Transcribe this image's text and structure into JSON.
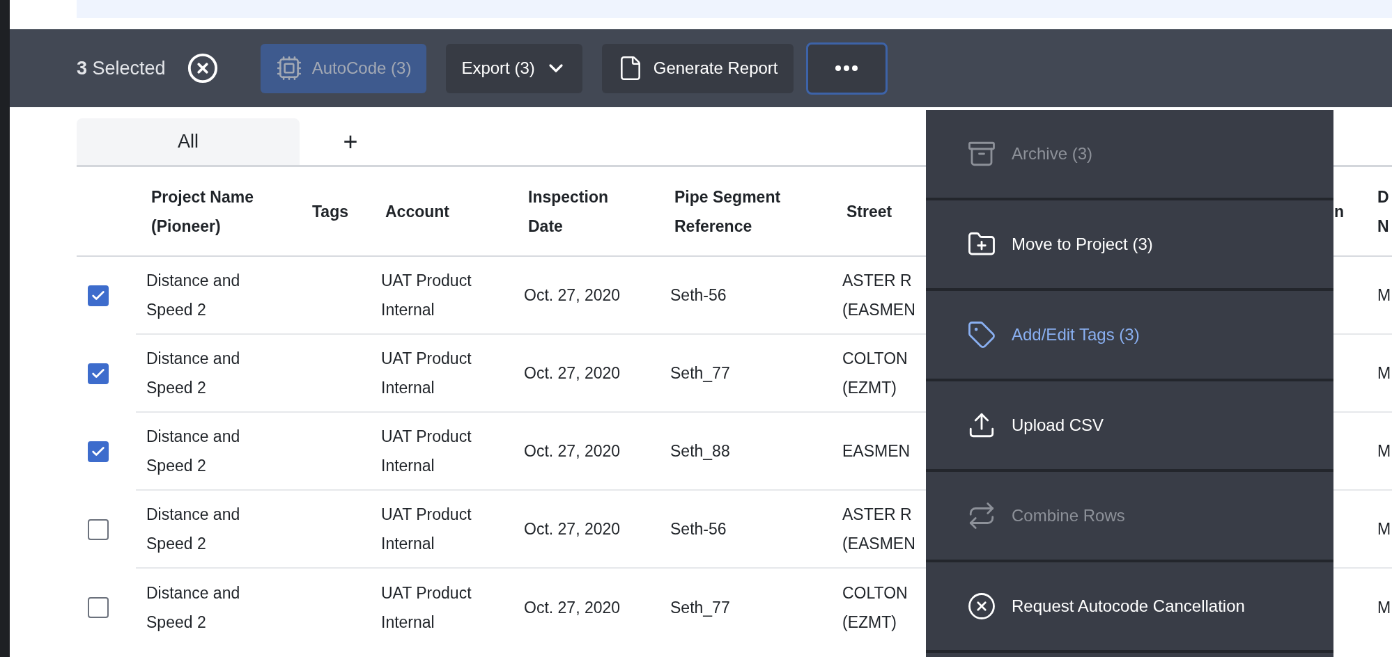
{
  "toolbar": {
    "count": "3",
    "selected_label": "Selected",
    "buttons": [
      {
        "kind": "autocode",
        "label": "AutoCode (3)",
        "disabled": true
      },
      {
        "kind": "dropdown",
        "label": "Export (3)",
        "disabled": false
      },
      {
        "kind": "report",
        "label": "Generate Report",
        "disabled": false
      }
    ],
    "more_button": {
      "expanded": true
    }
  },
  "tabs": [
    {
      "label": "All",
      "selected": true
    }
  ],
  "add_tab": "+",
  "table": {
    "columns": [
      "Project Name (Pioneer)",
      "Tags",
      "Account",
      "Inspection Date",
      "Pipe Segment Reference",
      "Street",
      "n",
      "D N"
    ],
    "rows": [
      {
        "checked": true,
        "cells": [
          "Distance and Speed 2",
          "",
          "UAT Product Internal",
          "Oct. 27, 2020",
          "Seth-56",
          "ASTER R (EASMEN",
          "",
          "M"
        ]
      },
      {
        "checked": true,
        "cells": [
          "Distance and Speed 2",
          "",
          "UAT Product Internal",
          "Oct. 27, 2020",
          "Seth_77",
          "COLTON (EZMT)",
          "",
          "M"
        ]
      },
      {
        "checked": true,
        "cells": [
          "Distance and Speed 2",
          "",
          "UAT Product Internal",
          "Oct. 27, 2020",
          "Seth_88",
          "EASMEN",
          "",
          "M"
        ]
      },
      {
        "checked": false,
        "cells": [
          "Distance and Speed 2",
          "",
          "UAT Product Internal",
          "Oct. 27, 2020",
          "Seth-56",
          "ASTER R (EASMEN",
          "",
          "M"
        ]
      },
      {
        "checked": false,
        "cells": [
          "Distance and Speed 2",
          "",
          "UAT Product Internal",
          "Oct. 27, 2020",
          "Seth_77",
          "COLTON (EZMT)",
          "",
          "M"
        ]
      }
    ]
  },
  "menu": {
    "items": [
      {
        "label": "Archive (3)",
        "disabled": true,
        "selected": false
      },
      {
        "label": "Move to Project (3)",
        "disabled": false,
        "selected": false
      },
      {
        "label": "Add/Edit Tags (3)",
        "disabled": false,
        "selected": true
      },
      {
        "label": "Upload CSV",
        "disabled": false,
        "selected": false
      },
      {
        "label": "Combine Rows",
        "disabled": true,
        "selected": false
      },
      {
        "label": "Request Autocode Cancellation",
        "disabled": false,
        "selected": false
      }
    ]
  }
}
